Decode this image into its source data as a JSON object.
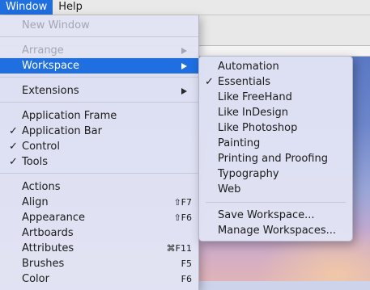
{
  "menubar": {
    "items": [
      "Window",
      "Help"
    ]
  },
  "window_menu": {
    "new_window": "New Window",
    "arrange": "Arrange",
    "workspace": "Workspace",
    "extensions": "Extensions",
    "application_frame": "Application Frame",
    "application_bar": "Application Bar",
    "control": "Control",
    "tools": "Tools",
    "actions": "Actions",
    "align": "Align",
    "align_shortcut": "⇧F7",
    "appearance": "Appearance",
    "appearance_shortcut": "⇧F6",
    "artboards": "Artboards",
    "attributes": "Attributes",
    "attributes_shortcut": "⌘F11",
    "brushes": "Brushes",
    "brushes_shortcut": "F5",
    "color": "Color",
    "color_shortcut": "F6"
  },
  "workspace_menu": {
    "items": [
      "Automation",
      "Essentials",
      "Like FreeHand",
      "Like InDesign",
      "Like Photoshop",
      "Painting",
      "Printing and Proofing",
      "Typography",
      "Web"
    ],
    "save_workspace": "Save Workspace...",
    "manage_workspaces": "Manage Workspaces..."
  },
  "check_glyph": "✓",
  "colors": {
    "highlight": "#1f6fe0",
    "menu_bg": "#e1e3f4",
    "disabled_text": "#a4a6b4"
  }
}
